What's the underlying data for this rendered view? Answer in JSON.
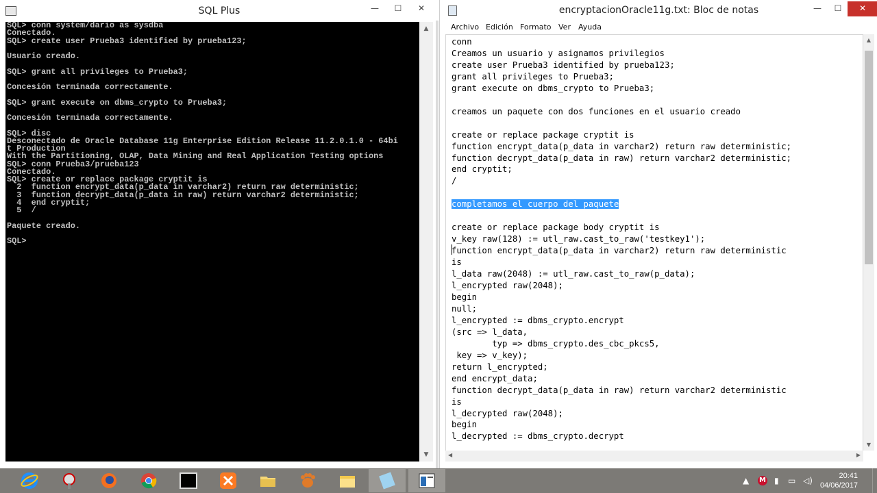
{
  "sqlplus": {
    "title": "SQL Plus",
    "controls": {
      "minimize": "—",
      "maximize": "☐",
      "close": "✕"
    },
    "console_lines": [
      "SQL> conn system/dario as sysdba",
      "Conectado.",
      "SQL> create user Prueba3 identified by prueba123;",
      "",
      "Usuario creado.",
      "",
      "SQL> grant all privileges to Prueba3;",
      "",
      "Concesión terminada correctamente.",
      "",
      "SQL> grant execute on dbms_crypto to Prueba3;",
      "",
      "Concesión terminada correctamente.",
      "",
      "SQL> disc",
      "Desconectado de Oracle Database 11g Enterprise Edition Release 11.2.0.1.0 - 64bi",
      "t Production",
      "With the Partitioning, OLAP, Data Mining and Real Application Testing options",
      "SQL> conn Prueba3/prueba123",
      "Conectado.",
      "SQL> create or replace package cryptit is",
      "  2  function encrypt_data(p_data in varchar2) return raw deterministic;",
      "  3  function decrypt_data(p_data in raw) return varchar2 deterministic;",
      "  4  end cryptit;",
      "  5  /",
      "",
      "Paquete creado.",
      "",
      "SQL>"
    ]
  },
  "notepad": {
    "title": "encryptacionOracle11g.txt: Bloc de notas",
    "controls": {
      "minimize": "—",
      "maximize": "☐",
      "close": "✕"
    },
    "menu": [
      "Archivo",
      "Edición",
      "Formato",
      "Ver",
      "Ayuda"
    ],
    "lines_before_selection": [
      "conn",
      "Creamos un usuario y asignamos privilegios",
      "create user Prueba3 identified by prueba123;",
      "grant all privileges to Prueba3;",
      "grant execute on dbms_crypto to Prueba3;",
      "",
      "creamos un paquete con dos funciones en el usuario creado",
      "",
      "create or replace package cryptit is",
      "function encrypt_data(p_data in varchar2) return raw deterministic;",
      "function decrypt_data(p_data in raw) return varchar2 deterministic;",
      "end cryptit;",
      "/",
      ""
    ],
    "selected_line": "completamos el cuerpo del paquete",
    "lines_after_selection": [
      "",
      "create or replace package body cryptit is",
      "v_key raw(128) := utl_raw.cast_to_raw('testkey1');",
      "function encrypt_data(p_data in varchar2) return raw deterministic",
      "is",
      "l_data raw(2048) := utl_raw.cast_to_raw(p_data);",
      "l_encrypted raw(2048);",
      "begin",
      "null;",
      "l_encrypted := dbms_crypto.encrypt",
      "(src => l_data,",
      "        typ => dbms_crypto.des_cbc_pkcs5,",
      " key => v_key);",
      "return l_encrypted;",
      "end encrypt_data;",
      "function decrypt_data(p_data in raw) return varchar2 deterministic",
      "is",
      "l_decrypted raw(2048);",
      "begin",
      "l_decrypted := dbms_crypto.decrypt"
    ]
  },
  "taskbar": {
    "apps": [
      "internet-explorer",
      "tools",
      "firefox",
      "chrome",
      "command-prompt",
      "xampp",
      "file-explorer",
      "paw-app",
      "folder",
      "notepad",
      "sqlplus"
    ],
    "tray_icons": [
      "up-arrow",
      "mcafee",
      "network",
      "battery-plug",
      "volume"
    ],
    "time": "20:41",
    "date": "04/06/2017"
  },
  "colors": {
    "console_bg": "#000000",
    "console_text": "#c0c0c0",
    "selection": "#3399ff",
    "taskbar": "#7c7a76",
    "close_button": "#c7312b"
  }
}
